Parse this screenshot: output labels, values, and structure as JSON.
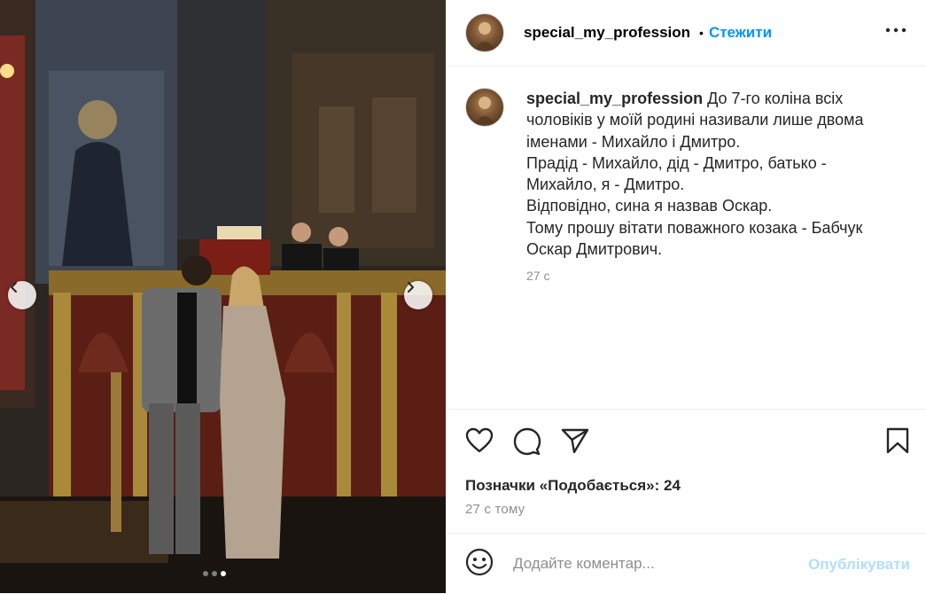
{
  "post": {
    "username": "special_my_profession",
    "separator": "•",
    "follow_label": "Стежити",
    "caption_text": "До 7-го коліна всіх чоловіків у моїй родині називали лише двома іменами - Михайло і Дмитро.\nПрадід - Михайло, дід - Дмитро, батько - Михайло, я - Дмитро.\nВідповідно, сина я назвав Оскар.\nТому прошу вітати поважного козака - Бабчук Оскар Дмитрович.",
    "caption_time": "27 с",
    "likes_text": "Позначки «Подобається»: 24",
    "posted_ago": "27 с тому",
    "comment_placeholder": "Додайте коментар...",
    "publish_label": "Опублікувати"
  },
  "carousel": {
    "current_index": 3,
    "total": 3
  },
  "icons": {
    "more": "more-horizontal-icon",
    "like": "heart-icon",
    "comment": "comment-icon",
    "share": "send-icon",
    "save": "bookmark-icon",
    "emoji": "emoji-icon",
    "prev": "chevron-left-icon",
    "next": "chevron-right-icon"
  },
  "colors": {
    "accent": "#0095f6",
    "publish_disabled": "#b2dffc",
    "muted": "#8e8e8e",
    "text": "#262626"
  }
}
